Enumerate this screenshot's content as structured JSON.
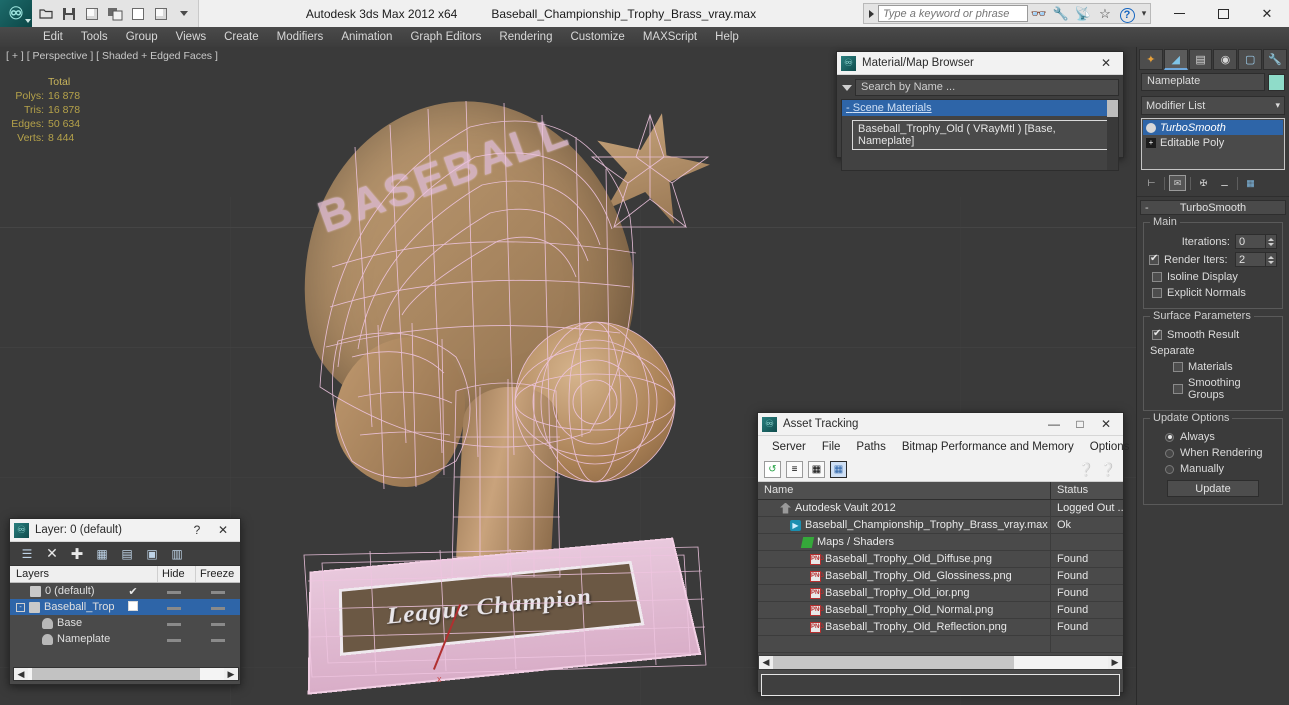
{
  "titlebar": {
    "app_title": "Autodesk 3ds Max  2012 x64",
    "file_title": "Baseball_Championship_Trophy_Brass_vray.max",
    "quick_access": [
      "open-icon",
      "save-icon",
      "undo-icon",
      "redo-icon",
      "new-icon",
      "reset-icon"
    ],
    "search_placeholder": "Type a keyword or phrase",
    "search_value": "",
    "search_icons": [
      "binoculars-icon",
      "wrench-icon",
      "satellite-icon",
      "star-icon"
    ],
    "help_label": "?",
    "minimize": "—",
    "maximize": "□",
    "close": "✕"
  },
  "menubar": {
    "items": [
      "Edit",
      "Tools",
      "Group",
      "Views",
      "Create",
      "Modifiers",
      "Animation",
      "Graph Editors",
      "Rendering",
      "Customize",
      "MAXScript",
      "Help"
    ]
  },
  "viewport": {
    "label": "[ + ] [ Perspective ] [ Shaded + Edged Faces ]",
    "stats": {
      "header": "Total",
      "rows": [
        {
          "key": "Polys:",
          "value": "16 878"
        },
        {
          "key": "Tris:",
          "value": "16 878"
        },
        {
          "key": "Edges:",
          "value": "50 634"
        },
        {
          "key": "Verts:",
          "value": "8 444"
        }
      ]
    },
    "model": {
      "fan_text": "BASEBALL",
      "nameplate_text": "League Champion",
      "wire_color": "#efc5e0",
      "surface_color": "#b08a63",
      "background_color": "#3a3a3a"
    }
  },
  "material_browser": {
    "title": "Material/Map Browser",
    "close_label": "✕",
    "search_placeholder": "Search by Name ...",
    "group_label": "Scene Materials",
    "group_collapse": "-",
    "items": [
      "Baseball_Trophy_Old  ( VRayMtl ) [Base, Nameplate]"
    ]
  },
  "asset_tracking": {
    "title": "Asset Tracking",
    "minimize": "—",
    "maximize": "□",
    "close": "✕",
    "menu": [
      "Server",
      "File",
      "Paths",
      "Bitmap Performance and Memory",
      "Options"
    ],
    "toolbar": [
      "refresh-icon",
      "list-view-icon",
      "thumbnail-view-icon",
      "table-view-icon",
      "help-pointer-icon",
      "help-icon"
    ],
    "columns": [
      "Name",
      "Status"
    ],
    "rows": [
      {
        "name": "Autodesk Vault 2012",
        "status": "Logged Out ...",
        "icon": "vault-icon",
        "indent": 1
      },
      {
        "name": "Baseball_Championship_Trophy_Brass_vray.max",
        "status": "Ok",
        "icon": "max-file-icon",
        "indent": 2
      },
      {
        "name": "Maps / Shaders",
        "status": "",
        "icon": "maps-icon",
        "indent": 3
      },
      {
        "name": "Baseball_Trophy_Old_Diffuse.png",
        "status": "Found",
        "icon": "png-icon",
        "indent": 4
      },
      {
        "name": "Baseball_Trophy_Old_Glossiness.png",
        "status": "Found",
        "icon": "png-icon",
        "indent": 4
      },
      {
        "name": "Baseball_Trophy_Old_ior.png",
        "status": "Found",
        "icon": "png-icon",
        "indent": 4
      },
      {
        "name": "Baseball_Trophy_Old_Normal.png",
        "status": "Found",
        "icon": "png-icon",
        "indent": 4
      },
      {
        "name": "Baseball_Trophy_Old_Reflection.png",
        "status": "Found",
        "icon": "png-icon",
        "indent": 4
      }
    ],
    "path_field_value": ""
  },
  "command_panel": {
    "tabs": [
      "create-tab",
      "modify-tab",
      "hierarchy-tab",
      "motion-tab",
      "display-tab",
      "utilities-tab"
    ],
    "active_tab_index": 1,
    "object_name": "Nameplate",
    "object_color": "#8fdcc9",
    "modifier_list_label": "Modifier List",
    "stack": [
      {
        "label": "TurboSmooth",
        "selected": true,
        "icon": "light-bulb-icon"
      },
      {
        "label": "Editable Poly",
        "selected": false,
        "icon": "plus-box-icon"
      }
    ],
    "stack_tools": [
      "pin-stack-icon",
      "show-end-result-icon",
      "make-unique-icon",
      "remove-modifier-icon",
      "configure-sets-icon"
    ],
    "rollout": {
      "title": "TurboSmooth",
      "collapse": "-",
      "main_group": "Main",
      "iterations_label": "Iterations:",
      "iterations_value": "0",
      "render_iters_label": "Render Iters:",
      "render_iters_value": "2",
      "render_iters_checked": true,
      "isoline_label": "Isoline Display",
      "isoline_checked": false,
      "explicit_label": "Explicit Normals",
      "explicit_checked": false,
      "surface_group": "Surface Parameters",
      "smooth_result_label": "Smooth Result",
      "smooth_result_checked": true,
      "separate_label": "Separate",
      "materials_label": "Materials",
      "materials_checked": false,
      "smoothing_groups_label": "Smoothing Groups",
      "smoothing_groups_checked": false,
      "update_group": "Update Options",
      "update_options": [
        "Always",
        "When Rendering",
        "Manually"
      ],
      "update_selected_index": 0,
      "update_button": "Update"
    }
  },
  "layer_dialog": {
    "title": "Layer: 0 (default)",
    "help_label": "?",
    "close_label": "✕",
    "toolbar": [
      "new-layer-icon",
      "delete-layer-icon",
      "add-layer-icon",
      "select-objects-icon",
      "select-highlight-icon",
      "add-selection-icon",
      "highlight-selection-icon"
    ],
    "columns": [
      "Layers",
      "Hide",
      "Freeze"
    ],
    "rows": [
      {
        "name": "0 (default)",
        "selected": false,
        "indent": 1,
        "current": "✔",
        "hide": "—",
        "freeze": "—",
        "icon": "layer-icon"
      },
      {
        "name": "Baseball_Trophy",
        "selected": true,
        "indent": 1,
        "current": "",
        "hide": "—",
        "freeze": "—",
        "icon": "layer-icon",
        "expandable": true
      },
      {
        "name": "Base",
        "selected": false,
        "indent": 2,
        "current": "",
        "hide": "—",
        "freeze": "—",
        "icon": "object-icon"
      },
      {
        "name": "Nameplate",
        "selected": false,
        "indent": 2,
        "current": "",
        "hide": "—",
        "freeze": "—",
        "icon": "object-icon"
      }
    ]
  }
}
